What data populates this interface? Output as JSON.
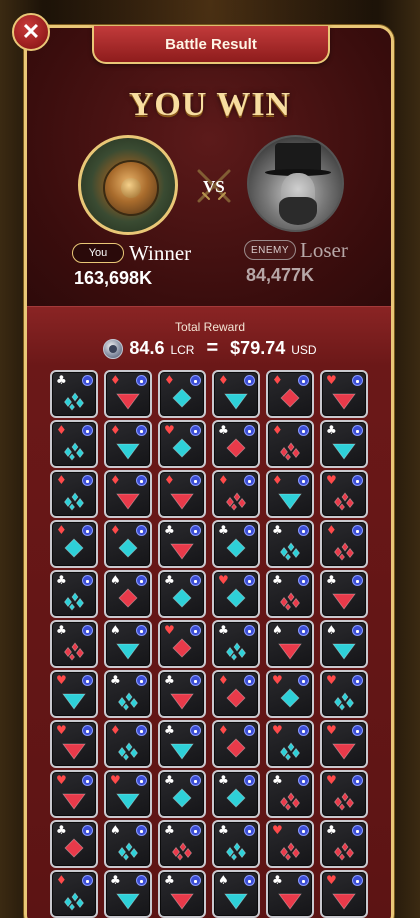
{
  "window": {
    "title": "Battle Result",
    "close_label": "✕"
  },
  "result": {
    "headline": "YOU WIN",
    "versus_label": "VS",
    "player": {
      "tag": "You",
      "status": "Winner",
      "score": "163,698K"
    },
    "enemy": {
      "tag": "ENEMY",
      "status": "Loser",
      "score": "84,477K"
    }
  },
  "reward": {
    "label": "Total Reward",
    "token_amount": "84.6",
    "token_unit": "LCR",
    "equals": "=",
    "usd_amount": "$79.74",
    "usd_unit": "USD"
  },
  "colors": {
    "red_gem": "#e83a4a",
    "teal_gem": "#2ed0d8",
    "gold": "#e9c777"
  },
  "items": [
    {
      "suit": "♣",
      "gem": "shards-teal"
    },
    {
      "suit": "♦",
      "gem": "single-red"
    },
    {
      "suit": "♦",
      "gem": "double-teal"
    },
    {
      "suit": "♦",
      "gem": "single-teal"
    },
    {
      "suit": "♦",
      "gem": "double-red"
    },
    {
      "suit": "♥",
      "gem": "single-red"
    },
    {
      "suit": "♦",
      "gem": "shards-teal"
    },
    {
      "suit": "♦",
      "gem": "single-teal"
    },
    {
      "suit": "♥",
      "gem": "double-teal"
    },
    {
      "suit": "♣",
      "gem": "double-red"
    },
    {
      "suit": "♦",
      "gem": "shards-red"
    },
    {
      "suit": "♣",
      "gem": "single-teal"
    },
    {
      "suit": "♦",
      "gem": "shards-teal"
    },
    {
      "suit": "♦",
      "gem": "single-red"
    },
    {
      "suit": "♦",
      "gem": "single-red"
    },
    {
      "suit": "♦",
      "gem": "shards-red"
    },
    {
      "suit": "♦",
      "gem": "single-teal"
    },
    {
      "suit": "♥",
      "gem": "shards-red"
    },
    {
      "suit": "♦",
      "gem": "double-teal"
    },
    {
      "suit": "♦",
      "gem": "double-teal"
    },
    {
      "suit": "♣",
      "gem": "single-red"
    },
    {
      "suit": "♣",
      "gem": "double-teal"
    },
    {
      "suit": "♣",
      "gem": "shards-teal"
    },
    {
      "suit": "♦",
      "gem": "shards-red"
    },
    {
      "suit": "♣",
      "gem": "shards-teal"
    },
    {
      "suit": "♠",
      "gem": "double-red"
    },
    {
      "suit": "♣",
      "gem": "double-teal"
    },
    {
      "suit": "♥",
      "gem": "double-teal"
    },
    {
      "suit": "♣",
      "gem": "shards-red"
    },
    {
      "suit": "♣",
      "gem": "single-red"
    },
    {
      "suit": "♣",
      "gem": "shards-red"
    },
    {
      "suit": "♠",
      "gem": "single-teal"
    },
    {
      "suit": "♥",
      "gem": "double-red"
    },
    {
      "suit": "♣",
      "gem": "shards-teal"
    },
    {
      "suit": "♠",
      "gem": "single-red"
    },
    {
      "suit": "♠",
      "gem": "single-teal"
    },
    {
      "suit": "♥",
      "gem": "single-teal"
    },
    {
      "suit": "♣",
      "gem": "shards-teal"
    },
    {
      "suit": "♣",
      "gem": "single-red"
    },
    {
      "suit": "♦",
      "gem": "double-red"
    },
    {
      "suit": "♥",
      "gem": "double-teal"
    },
    {
      "suit": "♥",
      "gem": "shards-teal"
    },
    {
      "suit": "♥",
      "gem": "single-red"
    },
    {
      "suit": "♦",
      "gem": "shards-teal"
    },
    {
      "suit": "♣",
      "gem": "single-teal"
    },
    {
      "suit": "♦",
      "gem": "double-red"
    },
    {
      "suit": "♥",
      "gem": "shards-teal"
    },
    {
      "suit": "♥",
      "gem": "single-red"
    },
    {
      "suit": "♥",
      "gem": "single-red"
    },
    {
      "suit": "♥",
      "gem": "single-teal"
    },
    {
      "suit": "♣",
      "gem": "double-teal"
    },
    {
      "suit": "♣",
      "gem": "double-teal"
    },
    {
      "suit": "♣",
      "gem": "shards-red"
    },
    {
      "suit": "♥",
      "gem": "shards-red"
    },
    {
      "suit": "♣",
      "gem": "double-red"
    },
    {
      "suit": "♠",
      "gem": "shards-teal"
    },
    {
      "suit": "♣",
      "gem": "shards-red"
    },
    {
      "suit": "♣",
      "gem": "shards-teal"
    },
    {
      "suit": "♥",
      "gem": "shards-red"
    },
    {
      "suit": "♣",
      "gem": "shards-red"
    },
    {
      "suit": "♦",
      "gem": "shards-teal"
    },
    {
      "suit": "♣",
      "gem": "single-teal"
    },
    {
      "suit": "♣",
      "gem": "single-red"
    },
    {
      "suit": "♠",
      "gem": "single-teal"
    },
    {
      "suit": "♣",
      "gem": "single-red"
    },
    {
      "suit": "♥",
      "gem": "single-red"
    }
  ]
}
